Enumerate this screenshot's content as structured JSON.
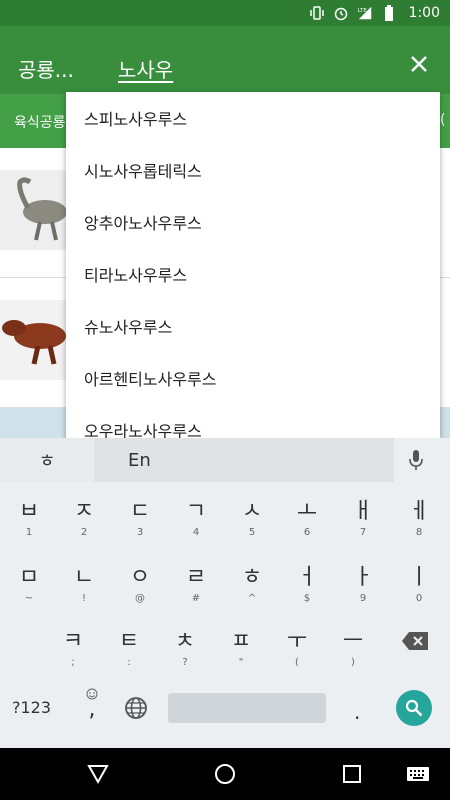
{
  "status_bar": {
    "time": "1:00",
    "icons": [
      "vibrate-icon",
      "alarm-icon",
      "lte-signal-icon",
      "battery-icon"
    ],
    "lte": "LTE"
  },
  "app_bar": {
    "title": "공룡...",
    "search_query": "노사우",
    "close_icon": "close-icon"
  },
  "tabs": {
    "left": "육식공룡",
    "right": "("
  },
  "suggestions": [
    "스피노사우루스",
    "시노사우롭테릭스",
    "앙추아노사우루스",
    "티라노사우루스",
    "슈노사우루스",
    "아르헨티노사우루스",
    "오우라노사우루스"
  ],
  "keyboard": {
    "mode_hangul": "ㅎ",
    "mode_en": "En",
    "row1": [
      {
        "main": "ㅂ",
        "sub": "1"
      },
      {
        "main": "ㅈ",
        "sub": "2"
      },
      {
        "main": "ㄷ",
        "sub": "3"
      },
      {
        "main": "ㄱ",
        "sub": "4"
      },
      {
        "main": "ㅅ",
        "sub": "5"
      },
      {
        "main": "ㅗ",
        "sub": "6"
      },
      {
        "main": "ㅐ",
        "sub": "7"
      },
      {
        "main": "ㅔ",
        "sub": "8"
      }
    ],
    "row2": [
      {
        "main": "ㅁ",
        "sub": "~"
      },
      {
        "main": "ㄴ",
        "sub": "!"
      },
      {
        "main": "ㅇ",
        "sub": "@"
      },
      {
        "main": "ㄹ",
        "sub": "#"
      },
      {
        "main": "ㅎ",
        "sub": "^"
      },
      {
        "main": "ㅓ",
        "sub": "$"
      },
      {
        "main": "ㅏ",
        "sub": "9"
      },
      {
        "main": "ㅣ",
        "sub": "0"
      }
    ],
    "row3": [
      {
        "main": "ㅋ",
        "sub": ";"
      },
      {
        "main": "ㅌ",
        "sub": ":"
      },
      {
        "main": "ㅊ",
        "sub": "?"
      },
      {
        "main": "ㅍ",
        "sub": "\""
      },
      {
        "main": "ㅜ",
        "sub": "("
      },
      {
        "main": "ㅡ",
        "sub": ")"
      }
    ],
    "symbols_label": "?123",
    "comma_label": ",",
    "period_label": ".",
    "accent_color": "#26a69a"
  },
  "colors": {
    "status_bar": "#2e7d32",
    "app_bar": "#388e3c",
    "tab_bar": "#43a047"
  }
}
